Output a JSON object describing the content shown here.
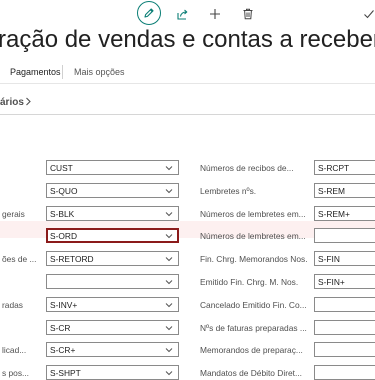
{
  "page": {
    "title": "ração de vendas e contas a receber"
  },
  "actions": {
    "pagamentos": "Pagamentos",
    "mais_opcoes": "Mais opções"
  },
  "section": {
    "title": "ários"
  },
  "left_rows": [
    {
      "label": "",
      "value": "CUST"
    },
    {
      "label": "",
      "value": "S-QUO"
    },
    {
      "label": "gerais",
      "value": "S-BLK"
    },
    {
      "label": "",
      "value": "S-ORD"
    },
    {
      "label": "ões de ...",
      "value": "S-RETORD"
    },
    {
      "label": "",
      "value": ""
    },
    {
      "label": "radas",
      "value": "S-INV+"
    },
    {
      "label": "",
      "value": "S-CR"
    },
    {
      "label": "licad...",
      "value": "S-CR+"
    },
    {
      "label": "s pos...",
      "value": "S-SHPT"
    }
  ],
  "right_rows": [
    {
      "label": "Números de recibos de...",
      "value": "S-RCPT"
    },
    {
      "label": "Lembretes nºs.",
      "value": "S-REM"
    },
    {
      "label": "Números de lembretes em...",
      "value": "S-REM+"
    },
    {
      "label": "Números de lembretes em...",
      "value": ""
    },
    {
      "label": "Fin. Chrg. Memorandos Nos.",
      "value": "S-FIN"
    },
    {
      "label": "Emitido Fin. Chrg. M. Nos.",
      "value": "S-FIN+"
    },
    {
      "label": "Cancelado Emitido Fin. Co...",
      "value": ""
    },
    {
      "label": "Nºs de faturas preparadas ...",
      "value": ""
    },
    {
      "label": "Memorandos de preparaç...",
      "value": ""
    },
    {
      "label": "Mandatos de Débito Diret...",
      "value": ""
    }
  ],
  "colors": {
    "accent": "#0a7e75",
    "active_field_border": "#8b1a1a",
    "highlight_row": "#fdf0f0"
  }
}
